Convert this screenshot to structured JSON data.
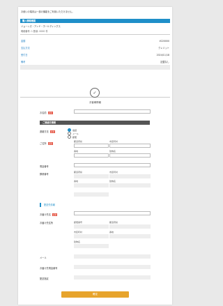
{
  "header": {
    "notice": "お使いの端末は一部の機能をご利用いただけません。",
    "bar_title": "購入情報確認",
    "subtitle": "ジョーンズ・アンド・ホールディングス",
    "meta": "明細番号: 1   数量: 0000 件"
  },
  "summary": [
    {
      "label": "金額",
      "value": "¥220000"
    },
    {
      "label": "支払方法",
      "value": "クレジット"
    },
    {
      "label": "受付日",
      "value": "2024/11/18"
    },
    {
      "label": "備考",
      "value": "記載なし"
    }
  ],
  "form": {
    "section_title": "お客様情報",
    "field_required_label": "必須",
    "name_label": "お名前",
    "section_head": "ご連絡先情報",
    "contact_method_label": "連絡方法",
    "radios": [
      "電話",
      "メール",
      "郵便"
    ],
    "address_label": "ご住所",
    "address_placeholders": [
      "都道府県",
      "市区町村",
      "番地",
      "建物名"
    ],
    "phone_label": "電話番号",
    "area_labels": [
      "郵便番号",
      "都道府県",
      "市区町村",
      "番地",
      "建物名"
    ],
    "delivery_section": "配送先情報",
    "delivery_name_label": "お届け先名",
    "delivery_address_label": "お届け先住所",
    "delivery_address_fields": [
      "郵便番号",
      "都道府県",
      "市区町村",
      "番地",
      "建物名"
    ],
    "email_label": "メール",
    "delivery_phone_label": "お届け先電話番号",
    "note_label": "配送指定",
    "submit_label": "確定"
  }
}
